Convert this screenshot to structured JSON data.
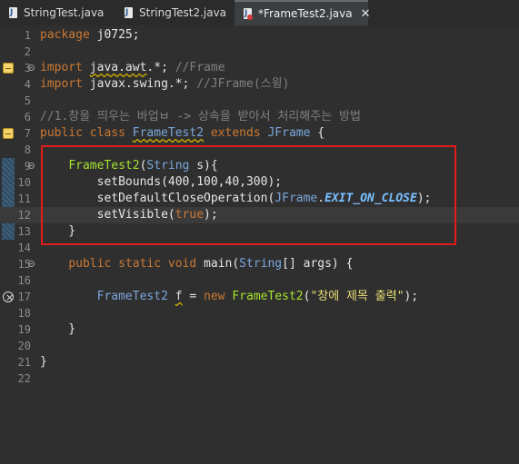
{
  "tabs": [
    {
      "label": "StringTest.java",
      "icon": "java-file-icon",
      "active": false
    },
    {
      "label": "StringTest2.java",
      "icon": "java-file-icon",
      "active": false
    },
    {
      "label": "*FrameTest2.java",
      "icon": "java-file-error-icon",
      "active": true,
      "close": "✕"
    }
  ],
  "lines": [
    {
      "n": "1",
      "segs": [
        [
          "kw",
          "package "
        ],
        [
          "plain",
          "j0725;"
        ]
      ]
    },
    {
      "n": "2",
      "segs": []
    },
    {
      "n": "3",
      "fold": true,
      "marker": "warn",
      "segs": [
        [
          "kw",
          "import "
        ],
        [
          "plain sq",
          "java.awt"
        ],
        [
          "plain",
          ".*; "
        ],
        [
          "cmt",
          "//Frame"
        ]
      ]
    },
    {
      "n": "4",
      "segs": [
        [
          "kw",
          "import "
        ],
        [
          "plain",
          "javax.swing.*; "
        ],
        [
          "cmt",
          "//JFrame(스윙)"
        ]
      ]
    },
    {
      "n": "5",
      "segs": []
    },
    {
      "n": "6",
      "segs": [
        [
          "cmt",
          "//1.창을 띄우는 바업ㅂ -> 상속을 받아서 처리해주는 방법"
        ]
      ]
    },
    {
      "n": "7",
      "marker": "warn",
      "segs": [
        [
          "kw",
          "public class "
        ],
        [
          "type sq",
          "FrameTest2"
        ],
        [
          "plain",
          " "
        ],
        [
          "kw",
          "extends "
        ],
        [
          "type",
          "JFrame"
        ],
        [
          "plain",
          " {"
        ]
      ]
    },
    {
      "n": "8",
      "segs": []
    },
    {
      "n": "9",
      "fold": true,
      "segs": [
        [
          "plain",
          "    "
        ],
        [
          "fn",
          "FrameTest2"
        ],
        [
          "plain",
          "("
        ],
        [
          "type",
          "String"
        ],
        [
          "plain",
          " s){"
        ]
      ]
    },
    {
      "n": "10",
      "segs": [
        [
          "plain",
          "        "
        ],
        [
          "plain",
          "setBounds(400,100,40,300);"
        ]
      ]
    },
    {
      "n": "11",
      "segs": [
        [
          "plain",
          "        "
        ],
        [
          "plain",
          "setDefaultCloseOperation("
        ],
        [
          "type",
          "JFrame"
        ],
        [
          "plain",
          "."
        ],
        [
          "const",
          "EXIT_ON_CLOSE"
        ],
        [
          "plain",
          ");"
        ]
      ]
    },
    {
      "n": "12",
      "current": true,
      "segs": [
        [
          "plain",
          "        "
        ],
        [
          "plain",
          "setVisible("
        ],
        [
          "kw",
          "true"
        ],
        [
          "plain",
          ");"
        ]
      ]
    },
    {
      "n": "13",
      "segs": [
        [
          "plain",
          "    }"
        ]
      ]
    },
    {
      "n": "14",
      "segs": []
    },
    {
      "n": "15",
      "fold": true,
      "segs": [
        [
          "plain",
          "    "
        ],
        [
          "kw",
          "public static void "
        ],
        [
          "plain",
          "main("
        ],
        [
          "type",
          "String"
        ],
        [
          "plain",
          "[] args) {"
        ]
      ]
    },
    {
      "n": "16",
      "segs": []
    },
    {
      "n": "17",
      "marker": "error",
      "segs": [
        [
          "plain",
          "        "
        ],
        [
          "type",
          "FrameTest2 "
        ],
        [
          "plain sq",
          "f"
        ],
        [
          "plain",
          " = "
        ],
        [
          "kw",
          "new "
        ],
        [
          "fn",
          "FrameTest2"
        ],
        [
          "plain",
          "("
        ],
        [
          "str",
          "\"창에 제목 출력\""
        ],
        [
          "plain",
          ");"
        ]
      ]
    },
    {
      "n": "18",
      "segs": []
    },
    {
      "n": "19",
      "segs": [
        [
          "plain",
          "    }"
        ]
      ]
    },
    {
      "n": "20",
      "segs": []
    },
    {
      "n": "21",
      "segs": [
        [
          "plain",
          "}"
        ]
      ]
    },
    {
      "n": "22",
      "segs": []
    }
  ]
}
